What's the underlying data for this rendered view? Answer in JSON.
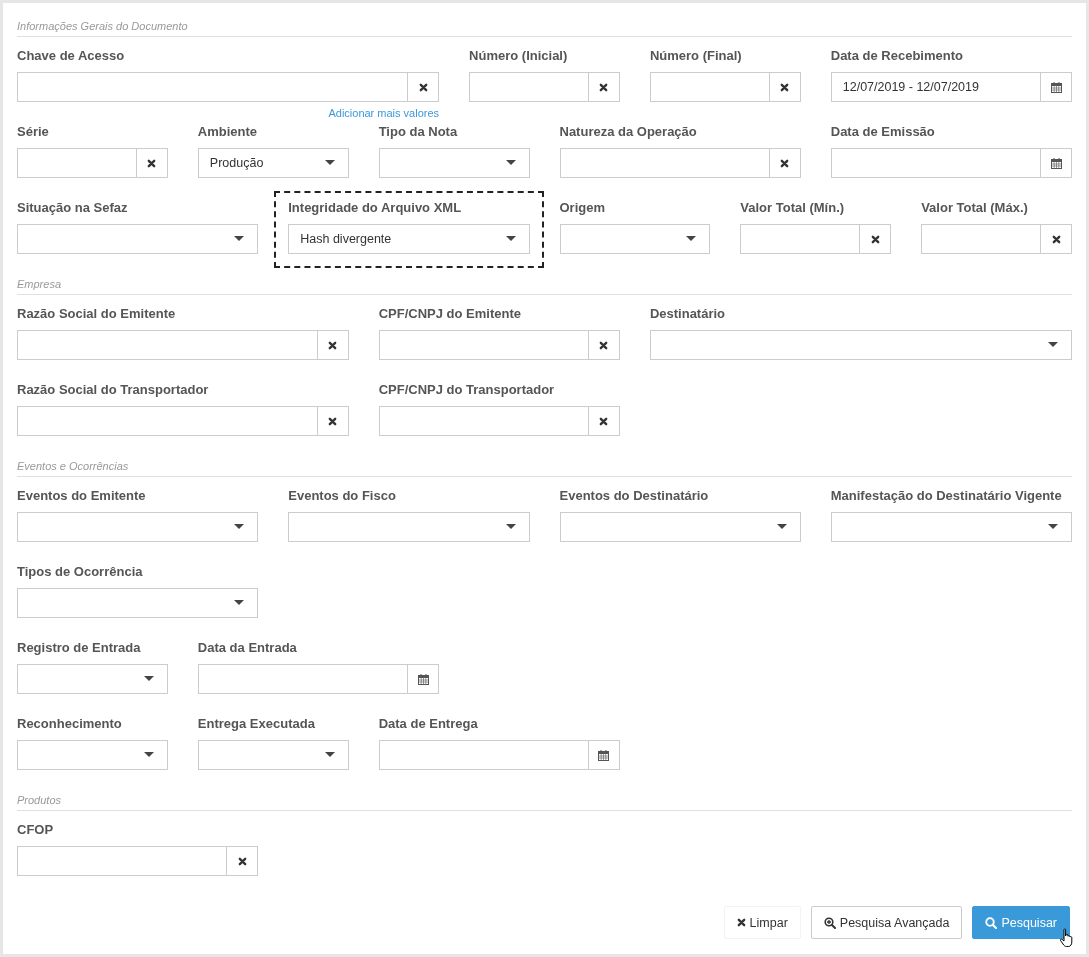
{
  "sections": [
    {
      "title": "Informações Gerais do Documento",
      "rows": [
        [
          {
            "label": "Chave de Acesso",
            "kind": "text",
            "focused": false,
            "link": "Adicionar mais valores"
          },
          {
            "label": "Número (Inicial)",
            "kind": "text",
            "focused": false
          },
          {
            "label": "Número (Final)",
            "kind": "text",
            "focused": false
          },
          {
            "label": "Data de Recebimento",
            "kind": "date",
            "value": "12/07/2019 - 12/07/2019",
            "focused": false
          }
        ],
        [
          {
            "label": "Série",
            "kind": "text",
            "focused": false
          },
          {
            "label": "Ambiente",
            "kind": "select",
            "value": "Produção",
            "focused": false
          },
          {
            "label": "Tipo da Nota",
            "kind": "select",
            "focused": false
          },
          {
            "label": "Natureza da Operação",
            "kind": "text",
            "focused": false
          },
          {
            "label": "Data de Emissão",
            "kind": "date",
            "focused": false
          }
        ],
        [
          {
            "label": "Situação na Sefaz",
            "kind": "select",
            "focused": false
          },
          {
            "label": "Integridade do Arquivo XML",
            "kind": "select",
            "value": "Hash divergente",
            "focused": true
          },
          {
            "label": "Origem",
            "kind": "select",
            "focused": false
          },
          {
            "label": "Valor Total (Mín.)",
            "kind": "text",
            "focused": false
          },
          {
            "label": "Valor Total (Máx.)",
            "kind": "text",
            "focused": false
          }
        ]
      ]
    },
    {
      "title": "Empresa",
      "rows": [
        [
          {
            "label": "Razão Social do Emitente",
            "kind": "text",
            "focused": false
          },
          {
            "label": "CPF/CNPJ do Emitente",
            "kind": "text",
            "focused": false
          },
          {
            "label": "Destinatário",
            "kind": "select",
            "focused": false
          }
        ],
        [
          {
            "label": "Razão Social do Transportador",
            "kind": "text",
            "focused": false
          },
          {
            "label": "CPF/CNPJ do Transportador",
            "kind": "text",
            "focused": false
          }
        ]
      ]
    },
    {
      "title": "Eventos e Ocorrências",
      "rows": [
        [
          {
            "label": "Eventos do Emitente",
            "kind": "select",
            "focused": false
          },
          {
            "label": "Eventos do Fisco",
            "kind": "select",
            "focused": false
          },
          {
            "label": "Eventos do Destinatário",
            "kind": "select",
            "focused": false
          },
          {
            "label": "Manifestação do Destinatário Vigente",
            "kind": "select",
            "focused": false
          }
        ],
        [
          {
            "label": "Tipos de Ocorrência",
            "kind": "select",
            "focused": false
          }
        ],
        [
          {
            "label": "Registro de Entrada",
            "kind": "select",
            "focused": false
          },
          {
            "label": "Data da Entrada",
            "kind": "date",
            "focused": false
          }
        ],
        [
          {
            "label": "Reconhecimento",
            "kind": "select",
            "focused": false
          },
          {
            "label": "Entrega Executada",
            "kind": "select",
            "focused": false
          },
          {
            "label": "Data de Entrega",
            "kind": "date",
            "focused": false
          }
        ]
      ]
    },
    {
      "title": "Produtos",
      "rows": [
        [
          {
            "label": "CFOP",
            "kind": "text",
            "focused": false
          }
        ]
      ]
    }
  ],
  "buttons": [
    {
      "label": "Limpar",
      "kind": "clear"
    },
    {
      "label": "Pesquisa Avançada",
      "kind": "advanced"
    },
    {
      "label": "Pesquisar",
      "kind": "primary"
    }
  ]
}
